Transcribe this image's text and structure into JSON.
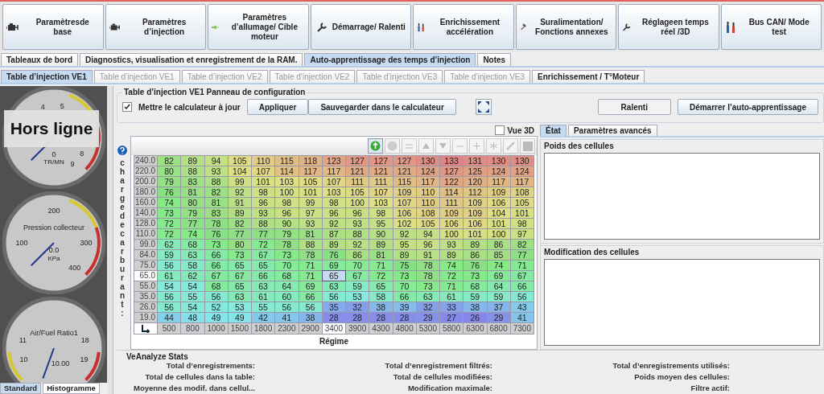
{
  "toolbar": [
    {
      "label": "Paramètresde base"
    },
    {
      "label": "Paramètres d’injection"
    },
    {
      "label": "Paramètres d’allumage/ Cible moteur"
    },
    {
      "label": "Démarrage/ Ralenti"
    },
    {
      "label": "Enrichissement accélération"
    },
    {
      "label": "Suralimentation/ Fonctions annexes"
    },
    {
      "label": "Réglageen temps réel /3D"
    },
    {
      "label": "Bus CAN/ Mode test"
    }
  ],
  "main_tabs": [
    {
      "label": "Tableaux de bord",
      "selected": false
    },
    {
      "label": "Diagnostics, visualisation et enregistrement de la RAM.",
      "selected": false
    },
    {
      "label": "Auto-apprentissage des temps d’injection",
      "selected": true
    },
    {
      "label": "Notes",
      "selected": false
    }
  ],
  "sub_tabs": [
    {
      "label": "Table d’injection VE1",
      "selected": true,
      "disabled": false
    },
    {
      "label": "Table d’injection VE1",
      "selected": false,
      "disabled": true
    },
    {
      "label": "Table d’injection VE2",
      "selected": false,
      "disabled": true
    },
    {
      "label": "Table d’injection VE2",
      "selected": false,
      "disabled": true
    },
    {
      "label": "Table d’injection VE3",
      "selected": false,
      "disabled": true
    },
    {
      "label": "Table d’injection VE3",
      "selected": false,
      "disabled": true
    },
    {
      "label": "Enrichissement / T°Moteur",
      "selected": false,
      "disabled": false
    }
  ],
  "gauges": [
    {
      "labels": [
        "4",
        "5",
        "8",
        "9"
      ],
      "reading": "0",
      "unit": "TR/MN"
    },
    {
      "labels": [
        "100",
        "200",
        "300",
        "400"
      ],
      "title": "Pression collecteur",
      "reading": "0.0",
      "unit": "KPa"
    },
    {
      "labels": [
        "11",
        "10",
        "18",
        "19"
      ],
      "title": "Air/Fuel Ratio1",
      "reading": "10.00"
    }
  ],
  "status_overlay": "Hors ligne",
  "gauge_tabs": [
    {
      "label": "Standard",
      "selected": true
    },
    {
      "label": "Histogramme",
      "selected": false
    }
  ],
  "config": {
    "title": "Table d’injection VE1 Panneau de configuration",
    "update_ecu": {
      "label": "Mettre le calculateur à jour",
      "checked": true
    },
    "buttons": [
      "Appliquer",
      "Sauvegarder dans le calculateur"
    ],
    "idle_button": "Ralenti",
    "start_button": "Démarrer l’auto-apprentissage"
  },
  "view_3d": {
    "label": "Vue 3D",
    "checked": false
  },
  "table_tools": [
    {
      "kind": "refresh",
      "disabled": false
    },
    {
      "kind": "circle",
      "disabled": true
    },
    {
      "kind": "equal",
      "disabled": true
    },
    {
      "kind": "up",
      "disabled": true
    },
    {
      "kind": "down",
      "disabled": true
    },
    {
      "kind": "minus",
      "disabled": true
    },
    {
      "kind": "plus",
      "disabled": true
    },
    {
      "kind": "star",
      "disabled": true
    },
    {
      "kind": "pencil",
      "disabled": true
    },
    {
      "kind": "square",
      "disabled": true
    }
  ],
  "table": {
    "y_axis_label": "charge de carburant :",
    "x_axis_label": "Régime",
    "columns": [
      {
        "label": "500",
        "selected": false
      },
      {
        "label": "800",
        "selected": false
      },
      {
        "label": "1000",
        "selected": false
      },
      {
        "label": "1500",
        "selected": false
      },
      {
        "label": "1800",
        "selected": false
      },
      {
        "label": "2300",
        "selected": false
      },
      {
        "label": "2900",
        "selected": false
      },
      {
        "label": "3400",
        "selected": true
      },
      {
        "label": "3900",
        "selected": false
      },
      {
        "label": "4300",
        "selected": false
      },
      {
        "label": "4800",
        "selected": false
      },
      {
        "label": "5300",
        "selected": false
      },
      {
        "label": "5800",
        "selected": false
      },
      {
        "label": "6300",
        "selected": false
      },
      {
        "label": "6800",
        "selected": false
      },
      {
        "label": "7300",
        "selected": false
      }
    ],
    "rows": [
      {
        "load": "240.0",
        "selected": false,
        "values": [
          "82",
          "89",
          "94",
          "105",
          "110",
          "115",
          "118",
          "123",
          "127",
          "127",
          "127",
          "130",
          "133",
          "131",
          "130",
          "130"
        ]
      },
      {
        "load": "220.0",
        "selected": false,
        "values": [
          "80",
          "88",
          "93",
          "104",
          "107",
          "114",
          "117",
          "117",
          "121",
          "121",
          "121",
          "124",
          "127",
          "125",
          "124",
          "124"
        ]
      },
      {
        "load": "200.0",
        "selected": false,
        "values": [
          "79",
          "83",
          "88",
          "99",
          "101",
          "103",
          "105",
          "107",
          "111",
          "111",
          "115",
          "117",
          "122",
          "120",
          "117",
          "117"
        ]
      },
      {
        "load": "180.0",
        "selected": false,
        "values": [
          "76",
          "81",
          "82",
          "92",
          "98",
          "100",
          "101",
          "103",
          "105",
          "107",
          "109",
          "110",
          "114",
          "112",
          "109",
          "108"
        ]
      },
      {
        "load": "160.0",
        "selected": false,
        "values": [
          "74",
          "80",
          "81",
          "91",
          "96",
          "98",
          "99",
          "98",
          "100",
          "103",
          "107",
          "110",
          "111",
          "109",
          "106",
          "105"
        ]
      },
      {
        "load": "140.0",
        "selected": false,
        "values": [
          "73",
          "79",
          "83",
          "89",
          "93",
          "96",
          "97",
          "96",
          "96",
          "98",
          "106",
          "108",
          "109",
          "109",
          "104",
          "101"
        ]
      },
      {
        "load": "128.0",
        "selected": false,
        "values": [
          "72",
          "77",
          "78",
          "82",
          "88",
          "90",
          "93",
          "92",
          "93",
          "95",
          "102",
          "105",
          "106",
          "106",
          "101",
          "98"
        ]
      },
      {
        "load": "110.0",
        "selected": false,
        "values": [
          "72",
          "74",
          "76",
          "77",
          "77",
          "79",
          "81",
          "87",
          "88",
          "90",
          "92",
          "94",
          "100",
          "101",
          "100",
          "97"
        ]
      },
      {
        "load": "99.0",
        "selected": false,
        "values": [
          "62",
          "68",
          "73",
          "80",
          "72",
          "78",
          "88",
          "89",
          "92",
          "89",
          "95",
          "96",
          "93",
          "89",
          "86",
          "82"
        ]
      },
      {
        "load": "84.0",
        "selected": false,
        "values": [
          "59",
          "63",
          "66",
          "73",
          "67",
          "73",
          "78",
          "76",
          "86",
          "81",
          "89",
          "91",
          "89",
          "86",
          "85",
          "77"
        ]
      },
      {
        "load": "75.0",
        "selected": false,
        "values": [
          "56",
          "58",
          "66",
          "65",
          "65",
          "70",
          "71",
          "69",
          "70",
          "71",
          "75",
          "78",
          "74",
          "76",
          "74",
          "71"
        ]
      },
      {
        "load": "65.0",
        "selected": true,
        "values": [
          "61",
          "62",
          "67",
          "67",
          "66",
          "68",
          "71",
          "65",
          "67",
          "72",
          "73",
          "78",
          "72",
          "73",
          "69",
          "67"
        ]
      },
      {
        "load": "55.0",
        "selected": false,
        "values": [
          "54",
          "54",
          "68",
          "65",
          "63",
          "64",
          "69",
          "63",
          "59",
          "65",
          "70",
          "73",
          "71",
          "68",
          "64",
          "66"
        ]
      },
      {
        "load": "35.0",
        "selected": false,
        "values": [
          "56",
          "55",
          "56",
          "63",
          "61",
          "60",
          "66",
          "56",
          "53",
          "58",
          "66",
          "63",
          "61",
          "59",
          "59",
          "56"
        ]
      },
      {
        "load": "26.0",
        "selected": false,
        "values": [
          "56",
          "54",
          "52",
          "53",
          "55",
          "56",
          "56",
          "35",
          "32",
          "38",
          "39",
          "32",
          "33",
          "38",
          "37",
          "43"
        ]
      },
      {
        "load": "19.0",
        "selected": false,
        "values": [
          "44",
          "48",
          "49",
          "49",
          "42",
          "41",
          "38",
          "28",
          "28",
          "28",
          "28",
          "29",
          "27",
          "26",
          "29",
          "41"
        ]
      }
    ]
  },
  "side_tabs": [
    {
      "label": "État",
      "selected": true
    },
    {
      "label": "Paramètres avancés",
      "selected": false
    }
  ],
  "side_groups": [
    "Poids des cellules",
    "Modification des cellules"
  ],
  "stats": {
    "title": "VeAnalyze Stats",
    "labels": [
      "Total d’enregistrements:",
      "Total d’enregistrement filtrés:",
      "Total d’enregistrements utilisés:",
      "Total de cellules dans la table:",
      "Total de cellules modifiées:",
      "Poids moyen des cellules:",
      "Moyenne des modif. dans cellul...",
      "Modification maximale:",
      "Filtre actif:"
    ]
  }
}
